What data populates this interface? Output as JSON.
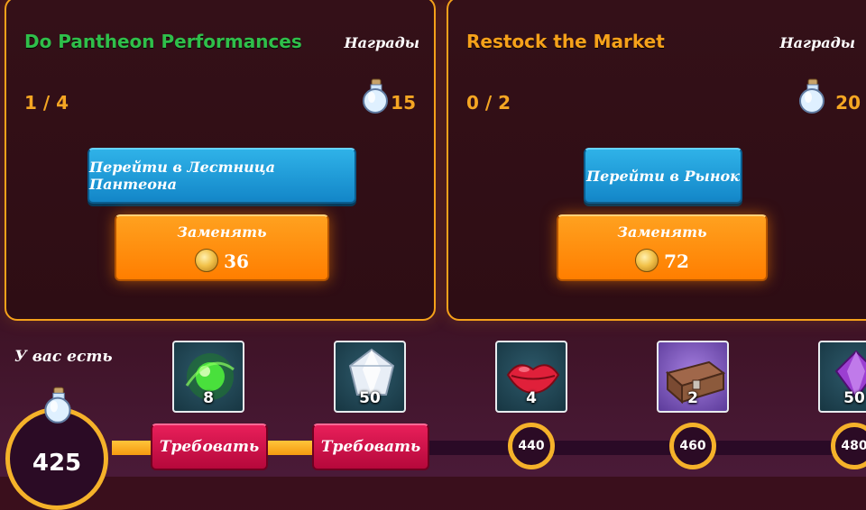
{
  "tasks": [
    {
      "title": "Do Pantheon Performances",
      "title_color": "#2fbf4a",
      "rewards_label": "Награды",
      "progress": "1 / 4",
      "reward_amount": "15",
      "reward_icon": "potion-icon",
      "go_button": "Перейти в Лестница Пантеона",
      "replace_label": "Заменять",
      "replace_cost": "36"
    },
    {
      "title": "Restock the Market",
      "title_color": "#f5a11a",
      "rewards_label": "Награды",
      "progress": "0 / 2",
      "reward_amount": "20",
      "reward_icon": "potion-icon",
      "go_button": "Перейти в Рынок",
      "replace_label": "Заменять",
      "replace_cost": "72"
    }
  ],
  "points": {
    "label": "У вас есть",
    "value": "425"
  },
  "track": {
    "progress_fraction": 0.37
  },
  "tiers": [
    {
      "icon": "green-orb-icon",
      "count": "8",
      "state": "claimable",
      "claim_label": "Требовать"
    },
    {
      "icon": "white-crystal-icon",
      "count": "50",
      "state": "claimable",
      "claim_label": "Требовать"
    },
    {
      "icon": "red-lips-icon",
      "count": "4",
      "state": "locked",
      "milestone": "440"
    },
    {
      "icon": "treasure-chest-icon",
      "count": "2",
      "state": "locked",
      "milestone": "460"
    },
    {
      "icon": "purple-gem-icon",
      "count": "50",
      "state": "locked",
      "milestone": "480"
    }
  ],
  "colors": {
    "accent_orange": "#f5a11a",
    "button_blue": "#1a94d6",
    "button_orange": "#ff8a00",
    "button_claim": "#d0104a"
  }
}
